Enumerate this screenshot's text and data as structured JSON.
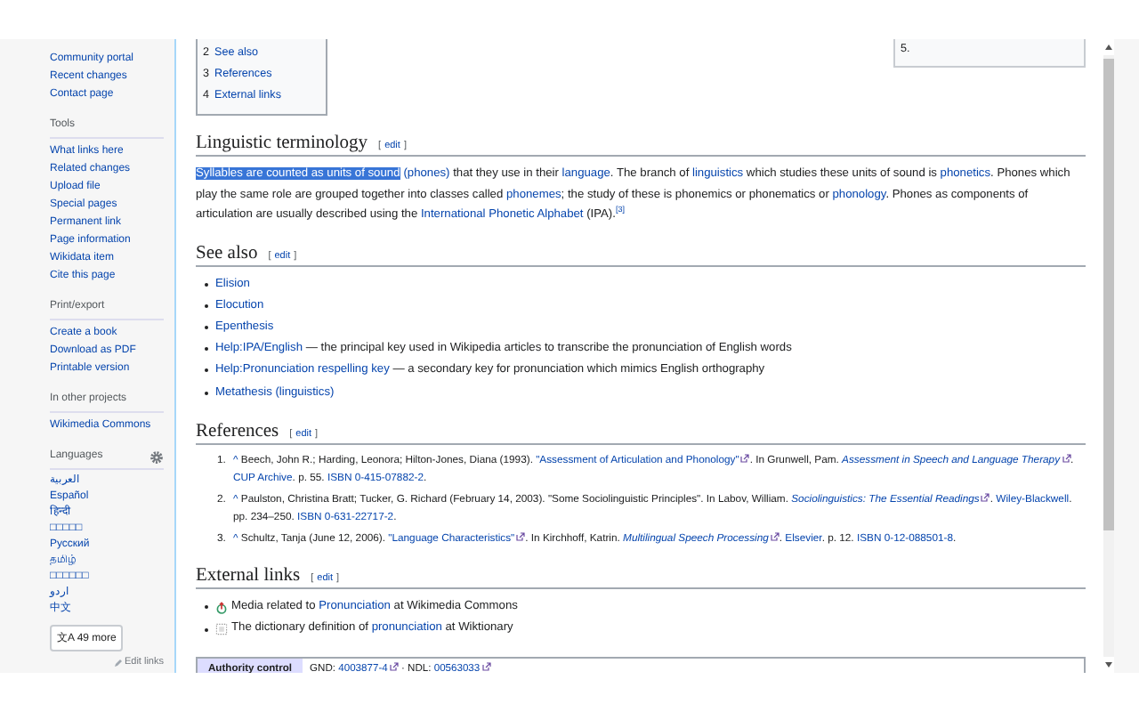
{
  "sidebar": {
    "top_links": [
      "Community portal",
      "Recent changes",
      "Contact page"
    ],
    "sections": [
      {
        "heading": "Tools",
        "items": [
          "What links here",
          "Related changes",
          "Upload file",
          "Special pages",
          "Permanent link",
          "Page information",
          "Wikidata item",
          "Cite this page"
        ]
      },
      {
        "heading": "Print/export",
        "items": [
          "Create a book",
          "Download as PDF",
          "Printable version"
        ]
      },
      {
        "heading": "In other projects",
        "items": [
          "Wikimedia Commons"
        ]
      }
    ],
    "languages": {
      "heading": "Languages",
      "items": [
        "العربية",
        "Español",
        "हिन्दी",
        "□□□□□",
        "Русский",
        "தமிழ்",
        "□□□□□□",
        "اردو",
        "中文"
      ],
      "more_button": "49 more",
      "more_icon": "文A",
      "edit_links": "Edit links"
    }
  },
  "toc": [
    {
      "number": "2",
      "label": "See also"
    },
    {
      "number": "3",
      "label": "References"
    },
    {
      "number": "4",
      "label": "External links"
    }
  ],
  "infobox_text": "5.",
  "sections": [
    {
      "kind": "paragraph",
      "heading": "Linguistic terminology",
      "edit": {
        "open": "[",
        "label": "edit",
        "close": "]"
      },
      "segments": [
        {
          "text": "Syllables are counted as units of sound",
          "highlighted": true
        },
        {
          "text": "(phones)",
          "link": true,
          "spaced": true
        },
        {
          "text": " that they use in their "
        },
        {
          "text": "language",
          "link": true
        },
        {
          "text": ". The branch of "
        },
        {
          "text": "linguistics",
          "link": true
        },
        {
          "text": " which studies these units of sound is "
        },
        {
          "text": "phonetics",
          "link": true
        },
        {
          "text": ". Phones which play the same role are grouped together into classes called "
        },
        {
          "text": "phonemes",
          "link": true
        },
        {
          "text": "; the study of these is phonemics or phonematics or "
        },
        {
          "text": "phonology",
          "link": true
        },
        {
          "text": ". Phones as components of articulation are usually described using the "
        },
        {
          "text": "International Phonetic Alphabet",
          "link": true
        },
        {
          "text": " (IPA)."
        },
        {
          "text": "[3]",
          "link": true,
          "sup": true
        }
      ]
    },
    {
      "kind": "list",
      "heading": "See also",
      "edit": {
        "open": "[",
        "label": "edit",
        "close": "]"
      },
      "items": [
        {
          "link": "Elision"
        },
        {
          "link": "Elocution"
        },
        {
          "link": "Epenthesis"
        },
        {
          "link": "Help:IPA/English",
          "note": " — the principal key used in Wikipedia articles to transcribe the pronunciation of English words"
        },
        {
          "link": "Help:Pronunciation respelling key",
          "note": " — a secondary key for pronunciation which mimics English orthography"
        },
        {
          "link": "Metathesis (linguistics)"
        }
      ]
    },
    {
      "kind": "references",
      "heading": "References",
      "edit": {
        "open": "[",
        "label": "edit",
        "close": "]"
      },
      "items": [
        {
          "number": "1.",
          "segments": [
            {
              "text": "^",
              "link": true
            },
            {
              "text": " Beech, John R.; Harding, Leonora; Hilton-Jones, Diana (1993). "
            },
            {
              "text": "\"Assessment of Articulation and Phonology\"",
              "link": true,
              "external": true
            },
            {
              "text": ". In Grunwell, Pam. "
            },
            {
              "text": "Assessment in Speech and Language Therapy",
              "link": true,
              "external": true,
              "italic": true
            },
            {
              "text": ". "
            },
            {
              "text": "CUP Archive",
              "link": true
            },
            {
              "text": ". p. 55. "
            },
            {
              "text": "ISBN 0-415-07882-2",
              "link": true
            },
            {
              "text": "."
            }
          ]
        },
        {
          "number": "2.",
          "segments": [
            {
              "text": "^",
              "link": true
            },
            {
              "text": " Paulston, Christina Bratt; Tucker, G. Richard (February 14, 2003). \"Some Sociolinguistic Principles\". In Labov, William. "
            },
            {
              "text": "Sociolinguistics: The Essential Readings",
              "link": true,
              "external": true,
              "italic": true
            },
            {
              "text": ". "
            },
            {
              "text": "Wiley-Blackwell",
              "link": true
            },
            {
              "text": ". pp. 234–250. "
            },
            {
              "text": "ISBN 0-631-22717-2",
              "link": true
            },
            {
              "text": "."
            }
          ]
        },
        {
          "number": "3.",
          "segments": [
            {
              "text": "^",
              "link": true
            },
            {
              "text": " Schultz, Tanja (June 12, 2006). "
            },
            {
              "text": "\"Language Characteristics\"",
              "link": true,
              "external": true
            },
            {
              "text": ". In Kirchhoff, Katrin. "
            },
            {
              "text": "Multilingual Speech Processing",
              "link": true,
              "external": true,
              "italic": true
            },
            {
              "text": ". "
            },
            {
              "text": "Elsevier",
              "link": true
            },
            {
              "text": ". p. 12. "
            },
            {
              "text": "ISBN 0-12-088501-8",
              "link": true
            },
            {
              "text": "."
            }
          ]
        }
      ]
    },
    {
      "kind": "external",
      "heading": "External links",
      "edit": {
        "open": "[",
        "label": "edit",
        "close": "]"
      },
      "items": [
        {
          "kind": "media",
          "segments": [
            {
              "text": "Media related to "
            },
            {
              "text": "Pronunciation",
              "link": true
            },
            {
              "text": " at Wikimedia Commons"
            }
          ]
        },
        {
          "kind": "dictionary",
          "segments": [
            {
              "text": "The dictionary definition of "
            },
            {
              "text": "pronunciation",
              "link": true
            },
            {
              "text": " at Wiktionary"
            }
          ]
        }
      ]
    }
  ],
  "authority_control": {
    "label": "Authority control",
    "segments": [
      {
        "text": "GND: "
      },
      {
        "text": "4003877-4",
        "link": true,
        "external": true
      },
      {
        "text": " · NDL: "
      },
      {
        "text": "00563033",
        "link": true,
        "external": true
      }
    ]
  }
}
